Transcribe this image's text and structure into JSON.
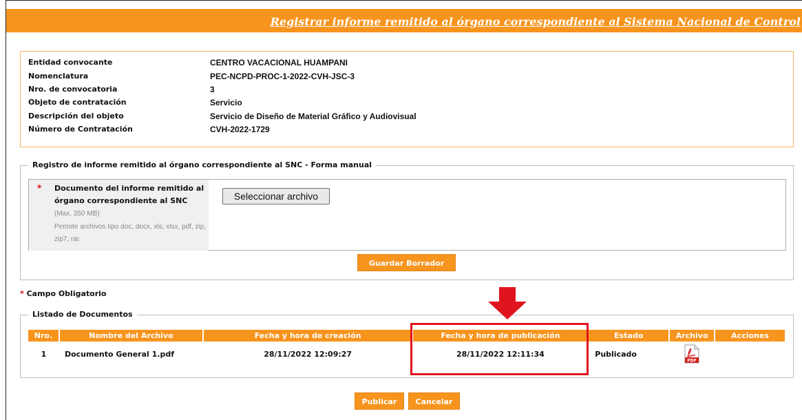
{
  "header": {
    "title": "Registrar informe remitido al órgano correspondiente al Sistema Nacional de Control"
  },
  "info": {
    "rows": [
      {
        "label": "Entidad convocante",
        "value": "CENTRO VACACIONAL HUAMPANI"
      },
      {
        "label": "Nomenclatura",
        "value": "PEC-NCPD-PROC-1-2022-CVH-JSC-3"
      },
      {
        "label": "Nro. de convocatoria",
        "value": "3"
      },
      {
        "label": "Objeto de contratación",
        "value": "Servicio"
      },
      {
        "label": "Descripción del objeto",
        "value": "Servicio de Diseño de Material Gráfico y Audiovisual"
      },
      {
        "label": "Número de Contratación",
        "value": "CVH-2022-1729"
      }
    ]
  },
  "registro": {
    "legend": "Registro de informe remitido al órgano correspondiente al SNC - Forma manual",
    "required_mark": "*",
    "doc_label": "Documento del informe remitido al órgano correspondiente al SNC",
    "max_size": "(Max. 350 MB)",
    "allowed_types": "Permite archivos tipo doc, docx, xls, xlsx, pdf, zip, zip7, rar.",
    "file_button": "Seleccionar archivo",
    "save_draft": "Guardar Borrador"
  },
  "mandatory": {
    "star": "*",
    "text": "Campo Obligatorio"
  },
  "listado": {
    "legend": "Listado de Documentos",
    "columns": [
      "Nro.",
      "Nombre del Archivo",
      "Fecha y hora de creación",
      "Fecha y hora de publicación",
      "Estado",
      "Archivo",
      "Acciones"
    ],
    "rows": [
      {
        "nro": "1",
        "nombre": "Documento General 1.pdf",
        "creacion": "28/11/2022 12:09:27",
        "publicacion": "28/11/2022 12:11:34",
        "estado": "Publicado",
        "archivo_icon": "pdf-icon",
        "archivo_text": "PDF"
      }
    ]
  },
  "footer": {
    "publish": "Publicar",
    "cancel": "Cancelar"
  },
  "colors": {
    "accent": "#f7941d",
    "highlight": "#e0141e",
    "required": "#d00000"
  }
}
